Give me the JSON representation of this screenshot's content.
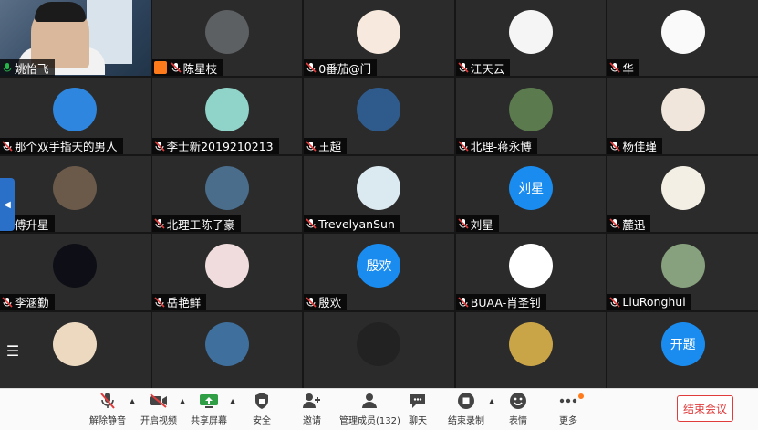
{
  "self_tile": {
    "name": "姚怡飞"
  },
  "participants": [
    {
      "name": "陈星枝",
      "avatar": "building-photo",
      "color": "#5c6063",
      "host_icon": true
    },
    {
      "name": "0番茄@门",
      "avatar": "monkey-cartoon",
      "color": "#f7e9dd"
    },
    {
      "name": "江天云",
      "avatar": "totoro-badge",
      "color": "#f5f5f5"
    },
    {
      "name": "华",
      "avatar": "cartoon-dog",
      "color": "#fafafa"
    },
    {
      "name": "那个双手指天的男人",
      "avatar": "cartoon-man",
      "color": "#2e86de"
    },
    {
      "name": "李士新2019210213",
      "avatar": "cartoon-character",
      "color": "#8fd3c9"
    },
    {
      "name": "王超",
      "avatar": "ocean-photo",
      "color": "#2f5b8c"
    },
    {
      "name": "北理-蒋永博",
      "avatar": "person-photo",
      "color": "#5b7b4f"
    },
    {
      "name": "杨佳瑾",
      "avatar": "dog-photo",
      "color": "#f0e6dc"
    },
    {
      "name": "傅升星",
      "avatar": "horse-photo",
      "color": "#6b5a4a"
    },
    {
      "name": "北理工陈子豪",
      "avatar": "rick-cartoon",
      "color": "#4a6d8c"
    },
    {
      "name": "TrevelyanSun",
      "avatar": "wave-art",
      "color": "#dbe9f1"
    },
    {
      "name": "刘星",
      "avatar_text": "刘星",
      "color": "#1a8cf0"
    },
    {
      "name": "麓迅",
      "avatar": "anime-girl",
      "color": "#f3efe4"
    },
    {
      "name": "李涵勤",
      "avatar": "dark-sketch",
      "color": "#0e0e16"
    },
    {
      "name": "岳艳鲜",
      "avatar": "anime-character",
      "color": "#f0dcdc"
    },
    {
      "name": "殷欢",
      "avatar_text": "殷欢",
      "color": "#1a8cf0"
    },
    {
      "name": "BUAA-肖圣钊",
      "avatar": "glasses-cartoon",
      "color": "#ffffff"
    },
    {
      "name": "LiuRonghui",
      "avatar": "person-outdoor",
      "color": "#87a07d"
    },
    {
      "name": "",
      "avatar": "flower-girl",
      "color": "#ecd9c0"
    },
    {
      "name": "",
      "avatar": "lake-photo",
      "color": "#3f6f9c"
    },
    {
      "name": "",
      "avatar": "man-photo",
      "color": "#222222"
    },
    {
      "name": "",
      "avatar": "beach-photo",
      "color": "#caa548"
    },
    {
      "name": "",
      "avatar_text": "开题",
      "color": "#1a8cf0"
    }
  ],
  "toolbar": {
    "unmute": "解除静音",
    "start_video": "开启视频",
    "share_screen": "共享屏幕",
    "security": "安全",
    "invite": "邀请",
    "manage_members": "管理成员(132)",
    "chat": "聊天",
    "end_recording": "结束录制",
    "reactions": "表情",
    "more": "更多",
    "end_meeting": "结束会议"
  }
}
